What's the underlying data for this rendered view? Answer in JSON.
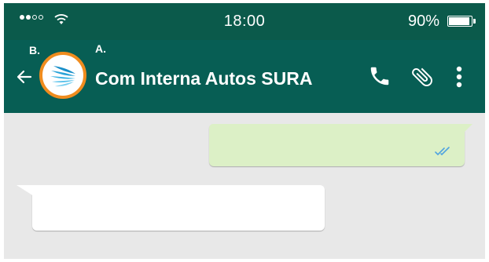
{
  "status_bar": {
    "time": "18:00",
    "battery_percent": "90%",
    "battery_level": 0.9,
    "signal_bars_filled": 2,
    "signal_bars_total": 4
  },
  "annotations": {
    "a": "A.",
    "b": "B."
  },
  "header": {
    "title": "Com Interna Autos SURA",
    "icons": [
      "back-arrow-icon",
      "phone-icon",
      "paperclip-icon",
      "more-vertical-icon"
    ]
  },
  "colors": {
    "status_bar": "#0b5a4b",
    "header": "#075e54",
    "chat_background": "#e8e8e8",
    "outgoing_bubble": "#dcf0c6",
    "incoming_bubble": "#ffffff",
    "avatar_ring": "#f08c1e",
    "read_ticks": "#4fa3e0"
  },
  "messages": [
    {
      "direction": "outgoing",
      "text": "",
      "status": "read"
    },
    {
      "direction": "incoming",
      "text": ""
    }
  ]
}
